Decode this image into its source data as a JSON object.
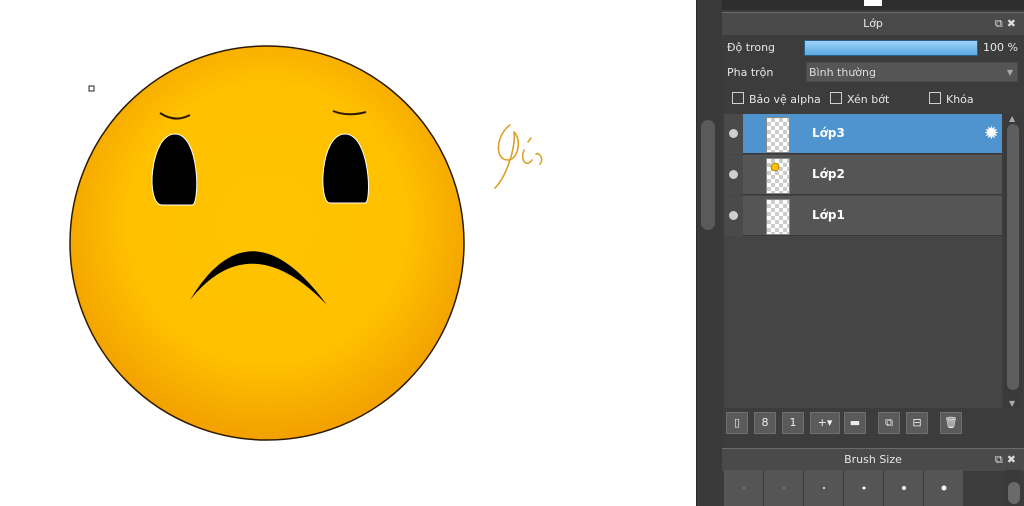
{
  "canvas": {
    "signature_text": "Gió",
    "face_color": "#FFC107",
    "signature_color": "#E0A028"
  },
  "layer_panel": {
    "title": "Lớp",
    "opacity_label": "Độ trong",
    "opacity_value": "100 %",
    "opacity_percent": 100,
    "blend_label": "Pha trộn",
    "blend_value": "Bình thường",
    "checkboxes": [
      {
        "label": "Bảo vệ alpha",
        "checked": false
      },
      {
        "label": "Xén bớt",
        "checked": false
      },
      {
        "label": "Khóa",
        "checked": false
      }
    ],
    "layers": [
      {
        "name": "Lớp3",
        "selected": true,
        "visible": true
      },
      {
        "name": "Lớp2",
        "selected": false,
        "visible": true
      },
      {
        "name": "Lớp1",
        "selected": false,
        "visible": true
      }
    ],
    "toolbar_icons": [
      "new-layer-icon",
      "new-layer-8bit-icon",
      "new-layer-1bit-icon",
      "add-layer-dropdown-icon",
      "folder-icon",
      "duplicate-icon",
      "merge-icon",
      "delete-icon"
    ],
    "selected_color": "#4F93CF"
  },
  "brush_panel": {
    "title": "Brush Size",
    "sizes_visible": 6
  }
}
